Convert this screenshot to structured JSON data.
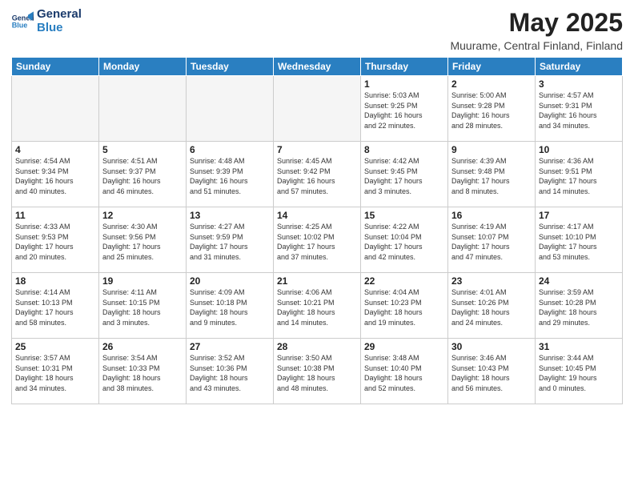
{
  "header": {
    "logo_line1": "General",
    "logo_line2": "Blue",
    "title": "May 2025",
    "subtitle": "Muurame, Central Finland, Finland"
  },
  "days_of_week": [
    "Sunday",
    "Monday",
    "Tuesday",
    "Wednesday",
    "Thursday",
    "Friday",
    "Saturday"
  ],
  "weeks": [
    [
      {
        "day": "",
        "info": ""
      },
      {
        "day": "",
        "info": ""
      },
      {
        "day": "",
        "info": ""
      },
      {
        "day": "",
        "info": ""
      },
      {
        "day": "1",
        "info": "Sunrise: 5:03 AM\nSunset: 9:25 PM\nDaylight: 16 hours\nand 22 minutes."
      },
      {
        "day": "2",
        "info": "Sunrise: 5:00 AM\nSunset: 9:28 PM\nDaylight: 16 hours\nand 28 minutes."
      },
      {
        "day": "3",
        "info": "Sunrise: 4:57 AM\nSunset: 9:31 PM\nDaylight: 16 hours\nand 34 minutes."
      }
    ],
    [
      {
        "day": "4",
        "info": "Sunrise: 4:54 AM\nSunset: 9:34 PM\nDaylight: 16 hours\nand 40 minutes."
      },
      {
        "day": "5",
        "info": "Sunrise: 4:51 AM\nSunset: 9:37 PM\nDaylight: 16 hours\nand 46 minutes."
      },
      {
        "day": "6",
        "info": "Sunrise: 4:48 AM\nSunset: 9:39 PM\nDaylight: 16 hours\nand 51 minutes."
      },
      {
        "day": "7",
        "info": "Sunrise: 4:45 AM\nSunset: 9:42 PM\nDaylight: 16 hours\nand 57 minutes."
      },
      {
        "day": "8",
        "info": "Sunrise: 4:42 AM\nSunset: 9:45 PM\nDaylight: 17 hours\nand 3 minutes."
      },
      {
        "day": "9",
        "info": "Sunrise: 4:39 AM\nSunset: 9:48 PM\nDaylight: 17 hours\nand 8 minutes."
      },
      {
        "day": "10",
        "info": "Sunrise: 4:36 AM\nSunset: 9:51 PM\nDaylight: 17 hours\nand 14 minutes."
      }
    ],
    [
      {
        "day": "11",
        "info": "Sunrise: 4:33 AM\nSunset: 9:53 PM\nDaylight: 17 hours\nand 20 minutes."
      },
      {
        "day": "12",
        "info": "Sunrise: 4:30 AM\nSunset: 9:56 PM\nDaylight: 17 hours\nand 25 minutes."
      },
      {
        "day": "13",
        "info": "Sunrise: 4:27 AM\nSunset: 9:59 PM\nDaylight: 17 hours\nand 31 minutes."
      },
      {
        "day": "14",
        "info": "Sunrise: 4:25 AM\nSunset: 10:02 PM\nDaylight: 17 hours\nand 37 minutes."
      },
      {
        "day": "15",
        "info": "Sunrise: 4:22 AM\nSunset: 10:04 PM\nDaylight: 17 hours\nand 42 minutes."
      },
      {
        "day": "16",
        "info": "Sunrise: 4:19 AM\nSunset: 10:07 PM\nDaylight: 17 hours\nand 47 minutes."
      },
      {
        "day": "17",
        "info": "Sunrise: 4:17 AM\nSunset: 10:10 PM\nDaylight: 17 hours\nand 53 minutes."
      }
    ],
    [
      {
        "day": "18",
        "info": "Sunrise: 4:14 AM\nSunset: 10:13 PM\nDaylight: 17 hours\nand 58 minutes."
      },
      {
        "day": "19",
        "info": "Sunrise: 4:11 AM\nSunset: 10:15 PM\nDaylight: 18 hours\nand 3 minutes."
      },
      {
        "day": "20",
        "info": "Sunrise: 4:09 AM\nSunset: 10:18 PM\nDaylight: 18 hours\nand 9 minutes."
      },
      {
        "day": "21",
        "info": "Sunrise: 4:06 AM\nSunset: 10:21 PM\nDaylight: 18 hours\nand 14 minutes."
      },
      {
        "day": "22",
        "info": "Sunrise: 4:04 AM\nSunset: 10:23 PM\nDaylight: 18 hours\nand 19 minutes."
      },
      {
        "day": "23",
        "info": "Sunrise: 4:01 AM\nSunset: 10:26 PM\nDaylight: 18 hours\nand 24 minutes."
      },
      {
        "day": "24",
        "info": "Sunrise: 3:59 AM\nSunset: 10:28 PM\nDaylight: 18 hours\nand 29 minutes."
      }
    ],
    [
      {
        "day": "25",
        "info": "Sunrise: 3:57 AM\nSunset: 10:31 PM\nDaylight: 18 hours\nand 34 minutes."
      },
      {
        "day": "26",
        "info": "Sunrise: 3:54 AM\nSunset: 10:33 PM\nDaylight: 18 hours\nand 38 minutes."
      },
      {
        "day": "27",
        "info": "Sunrise: 3:52 AM\nSunset: 10:36 PM\nDaylight: 18 hours\nand 43 minutes."
      },
      {
        "day": "28",
        "info": "Sunrise: 3:50 AM\nSunset: 10:38 PM\nDaylight: 18 hours\nand 48 minutes."
      },
      {
        "day": "29",
        "info": "Sunrise: 3:48 AM\nSunset: 10:40 PM\nDaylight: 18 hours\nand 52 minutes."
      },
      {
        "day": "30",
        "info": "Sunrise: 3:46 AM\nSunset: 10:43 PM\nDaylight: 18 hours\nand 56 minutes."
      },
      {
        "day": "31",
        "info": "Sunrise: 3:44 AM\nSunset: 10:45 PM\nDaylight: 19 hours\nand 0 minutes."
      }
    ]
  ]
}
